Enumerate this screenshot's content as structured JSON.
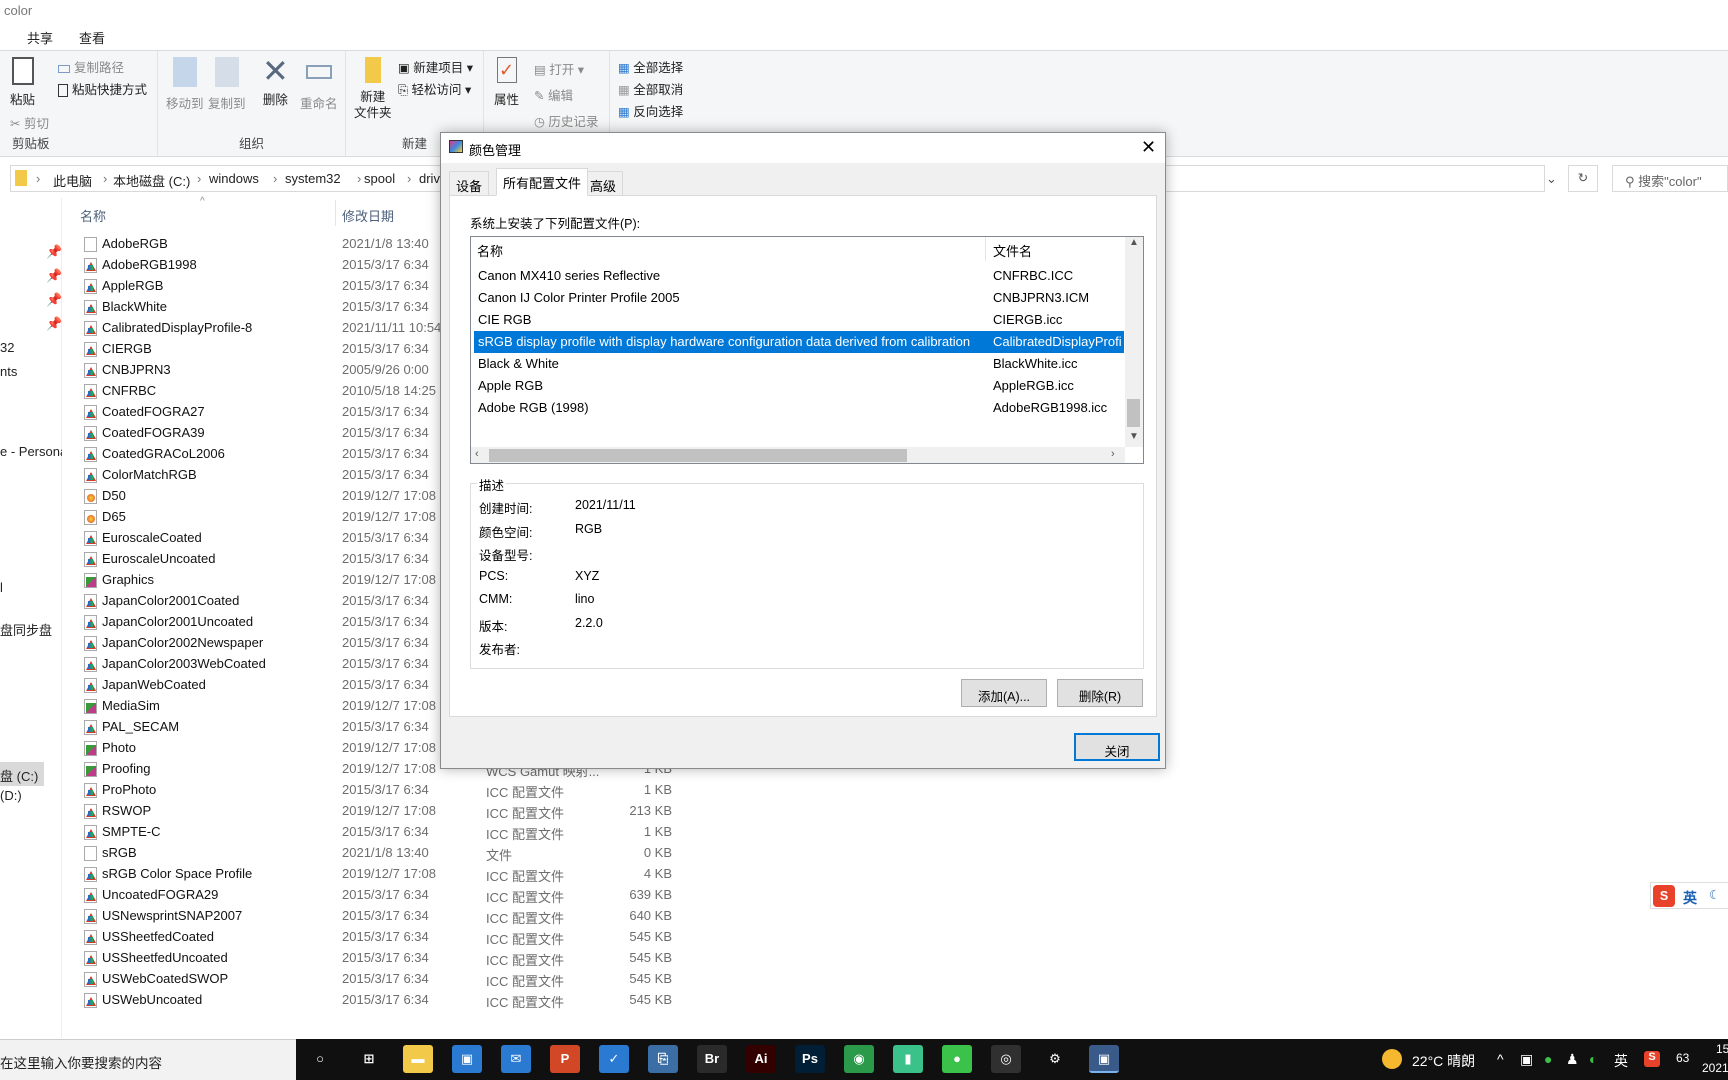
{
  "window": {
    "title": "color"
  },
  "ribbon_tabs": [
    "共享",
    "查看"
  ],
  "ribbon": {
    "clipboard": {
      "label": "剪贴板",
      "paste": "粘贴",
      "copy_path": "复制路径",
      "paste_shortcut": "粘贴快捷方式",
      "cut": "剪切"
    },
    "organize": {
      "label": "组织",
      "move_to": "移动到",
      "copy_to": "复制到",
      "delete": "删除",
      "rename": "重命名"
    },
    "new": {
      "label": "新建",
      "new_folder_1": "新建",
      "new_folder_2": "文件夹",
      "new_item": "新建项目",
      "easy_access": "轻松访问"
    },
    "open": {
      "properties": "属性",
      "open": "打开",
      "edit": "编辑",
      "history": "历史记录"
    },
    "select": {
      "select_all": "全部选择",
      "select_none": "全部取消",
      "invert": "反向选择"
    }
  },
  "address": {
    "crumbs": [
      "此电脑",
      "本地磁盘 (C:)",
      "windows",
      "system32",
      "spool",
      "driv"
    ],
    "search_placeholder": "搜索\"color\""
  },
  "columns": {
    "name": "名称",
    "date": "修改日期"
  },
  "nav": [
    "32",
    "nts",
    "e - Persona",
    "l",
    "盘同步盘",
    "盘 (C:)",
    "(D:)"
  ],
  "files": [
    {
      "name": "AdobeRGB",
      "date": "2021/1/8 13:40",
      "type": "",
      "size": "",
      "icon": "blank"
    },
    {
      "name": "AdobeRGB1998",
      "date": "2015/3/17 6:34",
      "type": "",
      "size": "",
      "icon": "icc"
    },
    {
      "name": "AppleRGB",
      "date": "2015/3/17 6:34",
      "type": "",
      "size": "",
      "icon": "icc"
    },
    {
      "name": "BlackWhite",
      "date": "2015/3/17 6:34",
      "type": "",
      "size": "",
      "icon": "icc"
    },
    {
      "name": "CalibratedDisplayProfile-8",
      "date": "2021/11/11 10:54",
      "type": "",
      "size": "",
      "icon": "icc"
    },
    {
      "name": "CIERGB",
      "date": "2015/3/17 6:34",
      "type": "",
      "size": "",
      "icon": "icc"
    },
    {
      "name": "CNBJPRN3",
      "date": "2005/9/26 0:00",
      "type": "",
      "size": "",
      "icon": "icc"
    },
    {
      "name": "CNFRBC",
      "date": "2010/5/18 14:25",
      "type": "",
      "size": "",
      "icon": "icc"
    },
    {
      "name": "CoatedFOGRA27",
      "date": "2015/3/17 6:34",
      "type": "",
      "size": "",
      "icon": "icc"
    },
    {
      "name": "CoatedFOGRA39",
      "date": "2015/3/17 6:34",
      "type": "",
      "size": "",
      "icon": "icc"
    },
    {
      "name": "CoatedGRACoL2006",
      "date": "2015/3/17 6:34",
      "type": "",
      "size": "",
      "icon": "icc"
    },
    {
      "name": "ColorMatchRGB",
      "date": "2015/3/17 6:34",
      "type": "",
      "size": "",
      "icon": "icc"
    },
    {
      "name": "D50",
      "date": "2019/12/7 17:08",
      "type": "",
      "size": "",
      "icon": "cd"
    },
    {
      "name": "D65",
      "date": "2019/12/7 17:08",
      "type": "",
      "size": "",
      "icon": "cd"
    },
    {
      "name": "EuroscaleCoated",
      "date": "2015/3/17 6:34",
      "type": "",
      "size": "",
      "icon": "icc"
    },
    {
      "name": "EuroscaleUncoated",
      "date": "2015/3/17 6:34",
      "type": "",
      "size": "",
      "icon": "icc"
    },
    {
      "name": "Graphics",
      "date": "2019/12/7 17:08",
      "type": "",
      "size": "",
      "icon": "gm"
    },
    {
      "name": "JapanColor2001Coated",
      "date": "2015/3/17 6:34",
      "type": "",
      "size": "",
      "icon": "icc"
    },
    {
      "name": "JapanColor2001Uncoated",
      "date": "2015/3/17 6:34",
      "type": "",
      "size": "",
      "icon": "icc"
    },
    {
      "name": "JapanColor2002Newspaper",
      "date": "2015/3/17 6:34",
      "type": "",
      "size": "",
      "icon": "icc"
    },
    {
      "name": "JapanColor2003WebCoated",
      "date": "2015/3/17 6:34",
      "type": "",
      "size": "",
      "icon": "icc"
    },
    {
      "name": "JapanWebCoated",
      "date": "2015/3/17 6:34",
      "type": "",
      "size": "",
      "icon": "icc"
    },
    {
      "name": "MediaSim",
      "date": "2019/12/7 17:08",
      "type": "",
      "size": "",
      "icon": "gm"
    },
    {
      "name": "PAL_SECAM",
      "date": "2015/3/17 6:34",
      "type": "",
      "size": "",
      "icon": "icc"
    },
    {
      "name": "Photo",
      "date": "2019/12/7 17:08",
      "type": "",
      "size": "",
      "icon": "gm"
    },
    {
      "name": "Proofing",
      "date": "2019/12/7 17:08",
      "type": "WCS Gamut 映射...",
      "size": "1 KB",
      "icon": "gm"
    },
    {
      "name": "ProPhoto",
      "date": "2015/3/17 6:34",
      "type": "ICC 配置文件",
      "size": "1 KB",
      "icon": "icc"
    },
    {
      "name": "RSWOP",
      "date": "2019/12/7 17:08",
      "type": "ICC 配置文件",
      "size": "213 KB",
      "icon": "icc"
    },
    {
      "name": "SMPTE-C",
      "date": "2015/3/17 6:34",
      "type": "ICC 配置文件",
      "size": "1 KB",
      "icon": "icc"
    },
    {
      "name": "sRGB",
      "date": "2021/1/8 13:40",
      "type": "文件",
      "size": "0 KB",
      "icon": "blank"
    },
    {
      "name": "sRGB Color Space Profile",
      "date": "2019/12/7 17:08",
      "type": "ICC 配置文件",
      "size": "4 KB",
      "icon": "icc"
    },
    {
      "name": "UncoatedFOGRA29",
      "date": "2015/3/17 6:34",
      "type": "ICC 配置文件",
      "size": "639 KB",
      "icon": "icc"
    },
    {
      "name": "USNewsprintSNAP2007",
      "date": "2015/3/17 6:34",
      "type": "ICC 配置文件",
      "size": "640 KB",
      "icon": "icc"
    },
    {
      "name": "USSheetfedCoated",
      "date": "2015/3/17 6:34",
      "type": "ICC 配置文件",
      "size": "545 KB",
      "icon": "icc"
    },
    {
      "name": "USSheetfedUncoated",
      "date": "2015/3/17 6:34",
      "type": "ICC 配置文件",
      "size": "545 KB",
      "icon": "icc"
    },
    {
      "name": "USWebCoatedSWOP",
      "date": "2015/3/17 6:34",
      "type": "ICC 配置文件",
      "size": "545 KB",
      "icon": "icc"
    },
    {
      "name": "USWebUncoated",
      "date": "2015/3/17 6:34",
      "type": "ICC 配置文件",
      "size": "545 KB",
      "icon": "icc"
    }
  ],
  "dialog": {
    "title": "颜色管理",
    "tabs": [
      "设备",
      "所有配置文件",
      "高级"
    ],
    "active_tab": 1,
    "list_label": "系统上安装了下列配置文件(P):",
    "list_columns": [
      "名称",
      "文件名"
    ],
    "profiles": [
      {
        "name": "Canon MX410 series Reflective",
        "file": "CNFRBC.ICC"
      },
      {
        "name": "Canon IJ Color Printer Profile 2005",
        "file": "CNBJPRN3.ICM"
      },
      {
        "name": "CIE RGB",
        "file": "CIERGB.icc"
      },
      {
        "name": "sRGB display profile with display hardware configuration data derived from calibration",
        "file": "CalibratedDisplayProfile-8.icc",
        "selected": true
      },
      {
        "name": "Black & White",
        "file": "BlackWhite.icc"
      },
      {
        "name": "Apple RGB",
        "file": "AppleRGB.icc"
      },
      {
        "name": "Adobe RGB (1998)",
        "file": "AdobeRGB1998.icc"
      }
    ],
    "description": {
      "label": "描述",
      "fields": [
        {
          "k": "创建时间:",
          "v": "2021/11/11"
        },
        {
          "k": "颜色空间:",
          "v": "RGB"
        },
        {
          "k": "设备型号:",
          "v": ""
        },
        {
          "k": "PCS:",
          "v": "XYZ"
        },
        {
          "k": "CMM:",
          "v": "lino"
        },
        {
          "k": "版本:",
          "v": "2.2.0"
        },
        {
          "k": "发布者:",
          "v": ""
        }
      ]
    },
    "add_button": "添加(A)...",
    "remove_button": "删除(R)",
    "close_button": "关闭",
    "selection_color": "#0078d7"
  },
  "taskbar": {
    "search_placeholder": "在这里输入你要搜索的内容",
    "apps": [
      "cortana",
      "task-view",
      "file-explorer",
      "store",
      "mail",
      "powerpoint",
      "todo",
      "python",
      "Br",
      "Ai",
      "Ps",
      "chrome",
      "notes",
      "wechat",
      "obs",
      "settings",
      "color-management"
    ],
    "weather": "22°C 晴朗",
    "ime": "英",
    "badge": "63",
    "clock_time": "15",
    "clock_date": "2021"
  },
  "ime_float": {
    "label": "英"
  }
}
